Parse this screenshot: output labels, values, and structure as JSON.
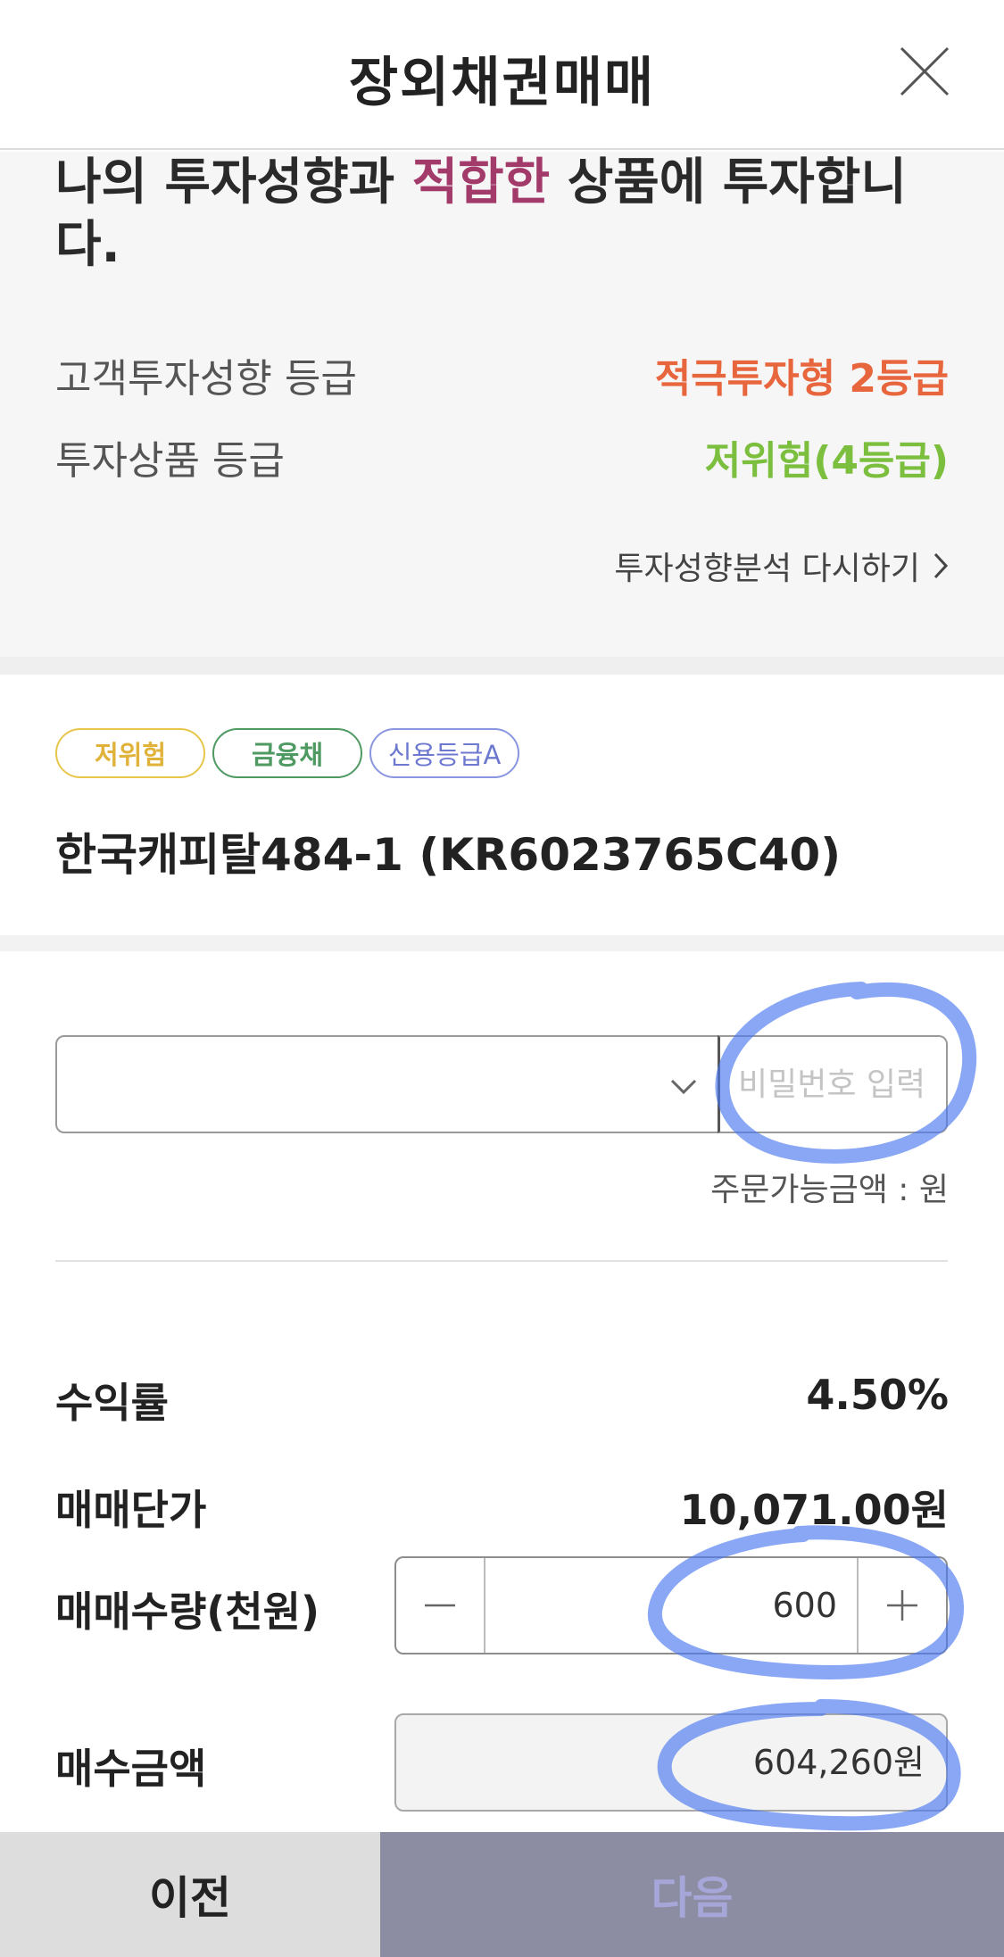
{
  "header": {
    "title": "장외채권매매"
  },
  "suitability": {
    "headline_prefix": "나의 투자성향과 ",
    "headline_accent": "적합한",
    "headline_suffix": " 상품에 투자합니다.",
    "customer_grade_label": "고객투자성향 등급",
    "customer_grade_value": "적극투자형 2등급",
    "product_grade_label": "투자상품 등급",
    "product_grade_value": "저위험(4등급)",
    "reanalyze_label": "투자성향분석 다시하기",
    "colors": {
      "accent": "#a23a6a",
      "customer_grade": "#e8663d",
      "product_grade": "#7cbf3f"
    }
  },
  "product": {
    "badges": [
      {
        "label": "저위험",
        "color": "#e0b23a"
      },
      {
        "label": "금융채",
        "color": "#4f9a62"
      },
      {
        "label": "신용등급A",
        "color": "#6c79cf"
      }
    ],
    "name": "한국캐피탈484-1 (KR6023765C40)"
  },
  "order": {
    "account_select_value": "",
    "password_placeholder": "비밀번호 입력",
    "available_amount": "주문가능금액 : 원",
    "yield_label": "수익률",
    "yield_value": "4.50%",
    "price_label": "매매단가",
    "price_value": "10,071.00원",
    "quantity_label": "매매수량(천원)",
    "quantity_value": "600",
    "amount_label": "매수금액",
    "amount_value": "604,260원"
  },
  "footer": {
    "prev_label": "이전",
    "next_label": "다음"
  },
  "icons": {
    "close": "close-icon",
    "chevron_right": "chevron-right-icon",
    "chevron_down": "chevron-down-icon",
    "minus": "minus-icon",
    "plus": "plus-icon"
  },
  "annotation_color": "#4a78f0"
}
